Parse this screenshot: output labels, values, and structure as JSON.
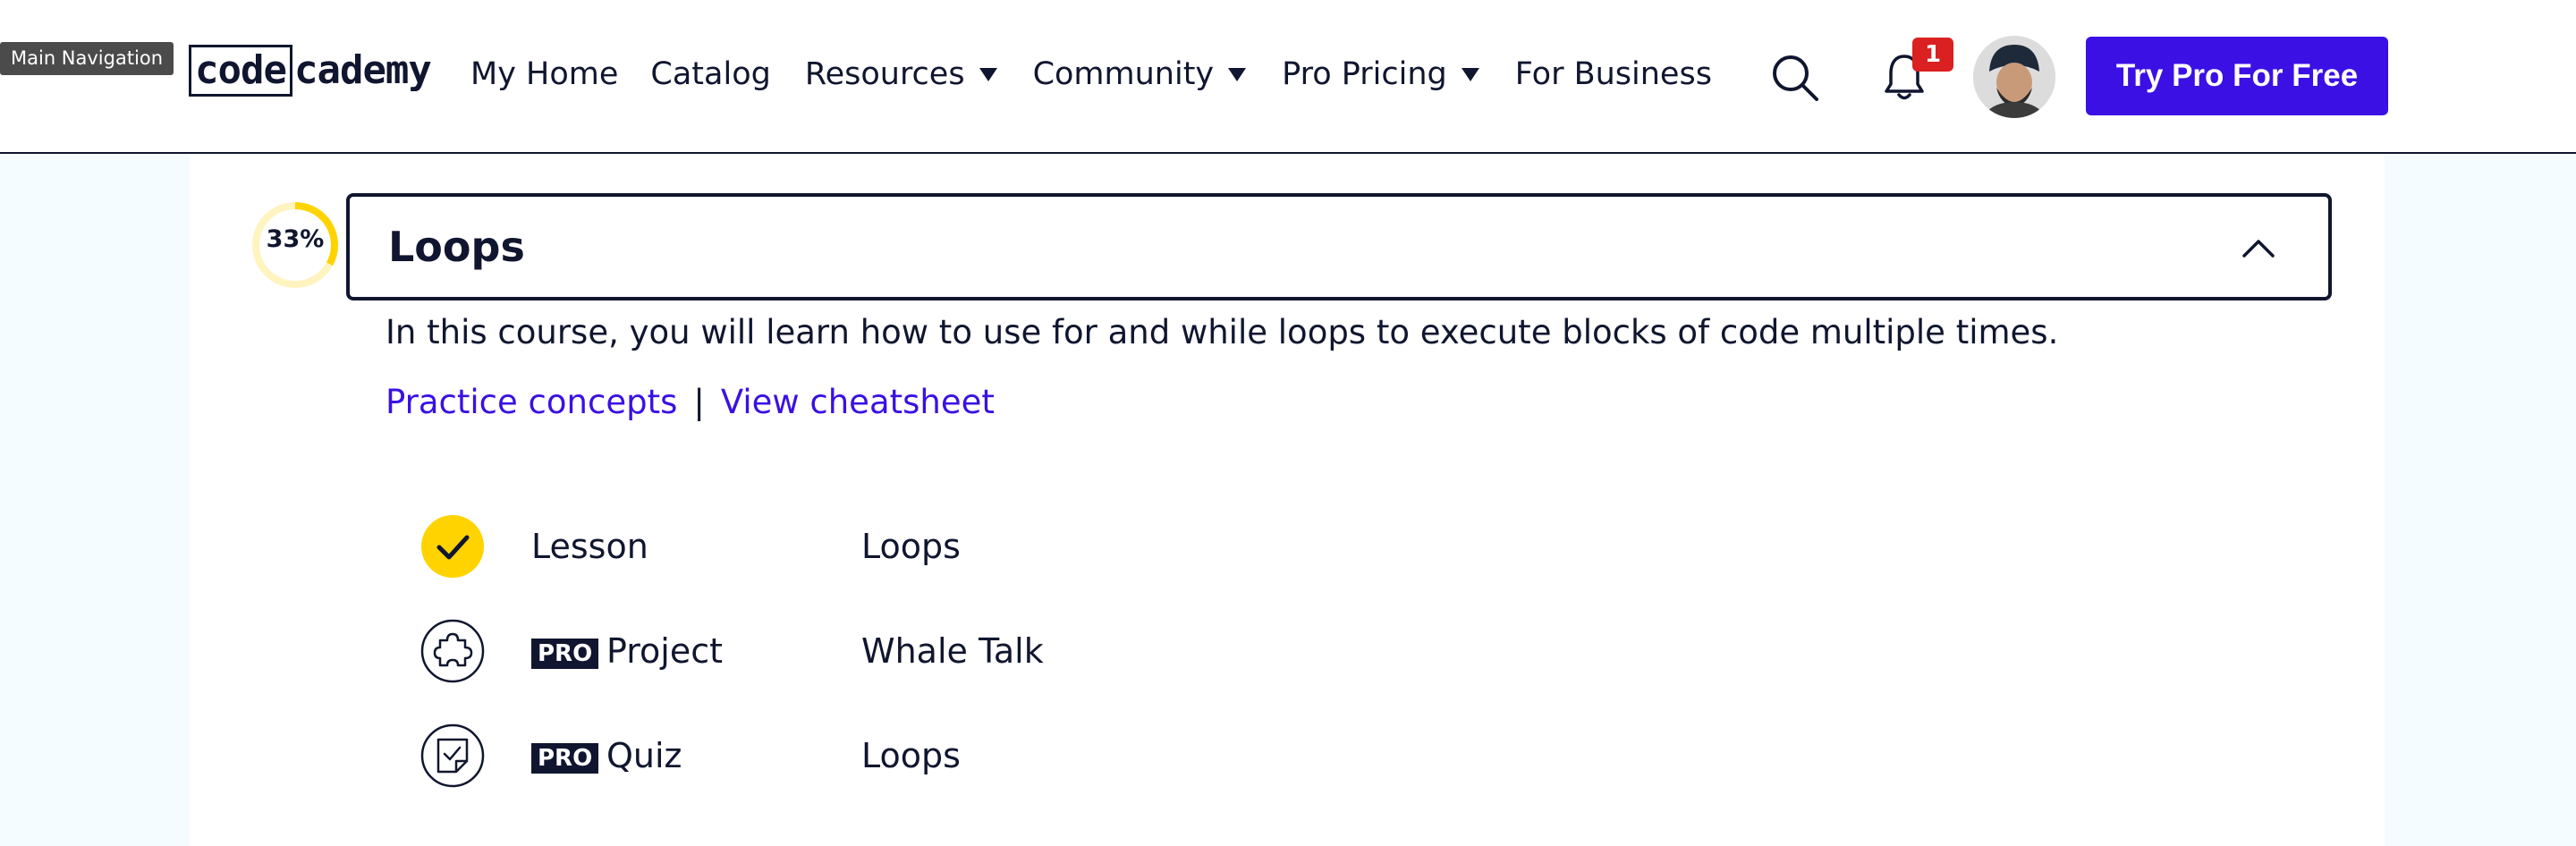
{
  "tooltip": {
    "text": "Main Navigation"
  },
  "logo": {
    "boxed": "code",
    "rest": "cademy"
  },
  "nav": {
    "items": [
      {
        "label": "My Home",
        "has_caret": false
      },
      {
        "label": "Catalog",
        "has_caret": false
      },
      {
        "label": "Resources",
        "has_caret": true
      },
      {
        "label": "Community",
        "has_caret": true
      },
      {
        "label": "Pro Pricing",
        "has_caret": true
      },
      {
        "label": "For Business",
        "has_caret": false
      }
    ]
  },
  "header_actions": {
    "search_icon": "search-icon",
    "notifications_icon": "bell-icon",
    "notification_count": "1",
    "cta_label": "Try Pro For Free"
  },
  "module": {
    "progress_percent": 33,
    "progress_label": "33%",
    "title": "Loops",
    "description": "In this course, you will learn how to use for and while loops to execute blocks of code multiple times.",
    "links": {
      "practice": "Practice concepts",
      "separator": "|",
      "cheatsheet": "View cheatsheet"
    },
    "items": [
      {
        "icon": "check-icon",
        "status": "completed",
        "pro": false,
        "type": "Lesson",
        "name": "Loops"
      },
      {
        "icon": "puzzle-icon",
        "status": "locked",
        "pro": true,
        "type": "Project",
        "name": "Whale Talk"
      },
      {
        "icon": "quiz-icon",
        "status": "locked",
        "pro": true,
        "type": "Quiz",
        "name": "Loops"
      }
    ],
    "pro_badge_label": "PRO"
  },
  "colors": {
    "brand_navy": "#10162f",
    "accent_purple": "#3a10e5",
    "progress_yellow": "#ffd300",
    "badge_red": "#da2020",
    "page_bg": "#f5fcff"
  }
}
